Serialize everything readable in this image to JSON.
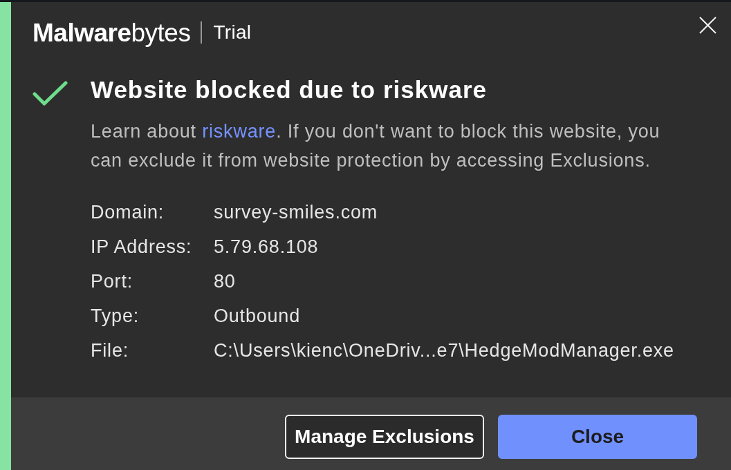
{
  "window": {
    "brand": "**Malware**bytes",
    "edition": "Trial"
  },
  "alert": {
    "title": "Website blocked due to riskware",
    "message": [
      {
        "kind": "text",
        "text": "Learn about "
      },
      {
        "kind": "link",
        "text": "riskware"
      },
      {
        "kind": "text",
        "text": ". If you don't want to block this website, you can exclude it from website protection by accessing Exclusions."
      }
    ]
  },
  "details": [
    {
      "label": "Domain:",
      "value": "survey-smiles.com"
    },
    {
      "label": "IP Address:",
      "value": "5.79.68.108"
    },
    {
      "label": "Port:",
      "value": "80"
    },
    {
      "label": "Type:",
      "value": "Outbound"
    },
    {
      "label": "File:",
      "value": "C:\\Users\\kienc\\OneDriv...e7\\HedgeModManager.exe"
    }
  ],
  "buttons": [
    {
      "label": "Manage Exclusions",
      "kind": "secondary"
    },
    {
      "label": "Close",
      "kind": "primary"
    }
  ]
}
